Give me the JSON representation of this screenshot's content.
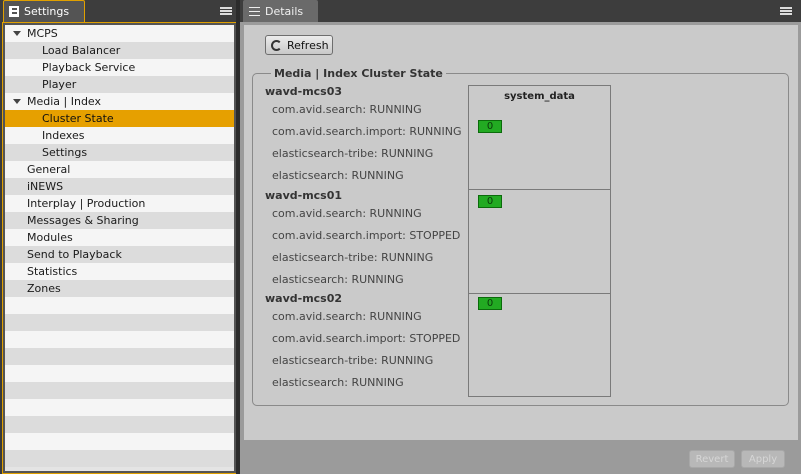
{
  "left_tab": {
    "label": "Settings"
  },
  "tree": [
    {
      "label": "MCPS",
      "level": 0,
      "expanded": true
    },
    {
      "label": "Load Balancer",
      "level": 1
    },
    {
      "label": "Playback Service",
      "level": 1
    },
    {
      "label": "Player",
      "level": 1
    },
    {
      "label": "Media | Index",
      "level": 0,
      "expanded": true
    },
    {
      "label": "Cluster State",
      "level": 1,
      "selected": true
    },
    {
      "label": "Indexes",
      "level": 1
    },
    {
      "label": "Settings",
      "level": 1
    },
    {
      "label": "General",
      "level": 0
    },
    {
      "label": "iNEWS",
      "level": 0
    },
    {
      "label": "Interplay | Production",
      "level": 0
    },
    {
      "label": "Messages & Sharing",
      "level": 0
    },
    {
      "label": "Modules",
      "level": 0
    },
    {
      "label": "Send to Playback",
      "level": 0
    },
    {
      "label": "Statistics",
      "level": 0
    },
    {
      "label": "Zones",
      "level": 0
    }
  ],
  "right_tab": {
    "label": "Details"
  },
  "refresh_label": "Refresh",
  "group_title": "Media | Index Cluster State",
  "column_header": "system_data",
  "hosts": [
    {
      "name": "wavd-mcs03",
      "services": [
        "com.avid.search: RUNNING",
        "com.avid.search.import: RUNNING",
        "elasticsearch-tribe: RUNNING",
        "elasticsearch: RUNNING"
      ],
      "badge": "0"
    },
    {
      "name": "wavd-mcs01",
      "services": [
        "com.avid.search: RUNNING",
        "com.avid.search.import: STOPPED",
        "elasticsearch-tribe: RUNNING",
        "elasticsearch: RUNNING"
      ],
      "badge": "0"
    },
    {
      "name": "wavd-mcs02",
      "services": [
        "com.avid.search: RUNNING",
        "com.avid.search.import: STOPPED",
        "elasticsearch-tribe: RUNNING",
        "elasticsearch: RUNNING"
      ],
      "badge": "0"
    }
  ],
  "footer": {
    "revert": "Revert",
    "apply": "Apply"
  },
  "colors": {
    "accent": "#e6a000",
    "badge": "#22aa22"
  }
}
